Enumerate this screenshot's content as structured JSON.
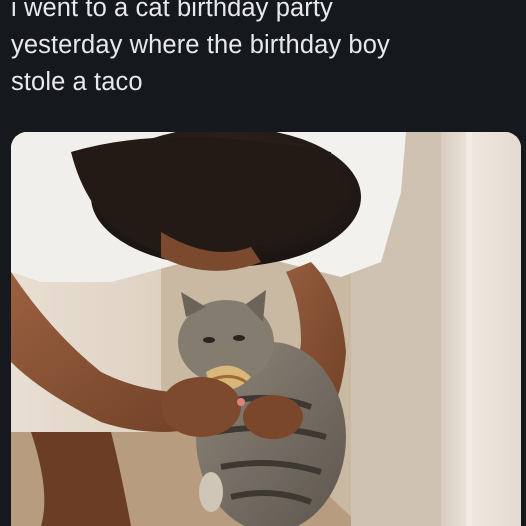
{
  "post": {
    "text": "i went to a cat birthday party\nyesterday where the birthday boy\nstole a taco"
  },
  "media": {
    "type": "video-thumbnail",
    "subjects": [
      "person",
      "cat",
      "taco"
    ]
  },
  "colors": {
    "background": "#15181c",
    "text": "#e7e9ea"
  }
}
